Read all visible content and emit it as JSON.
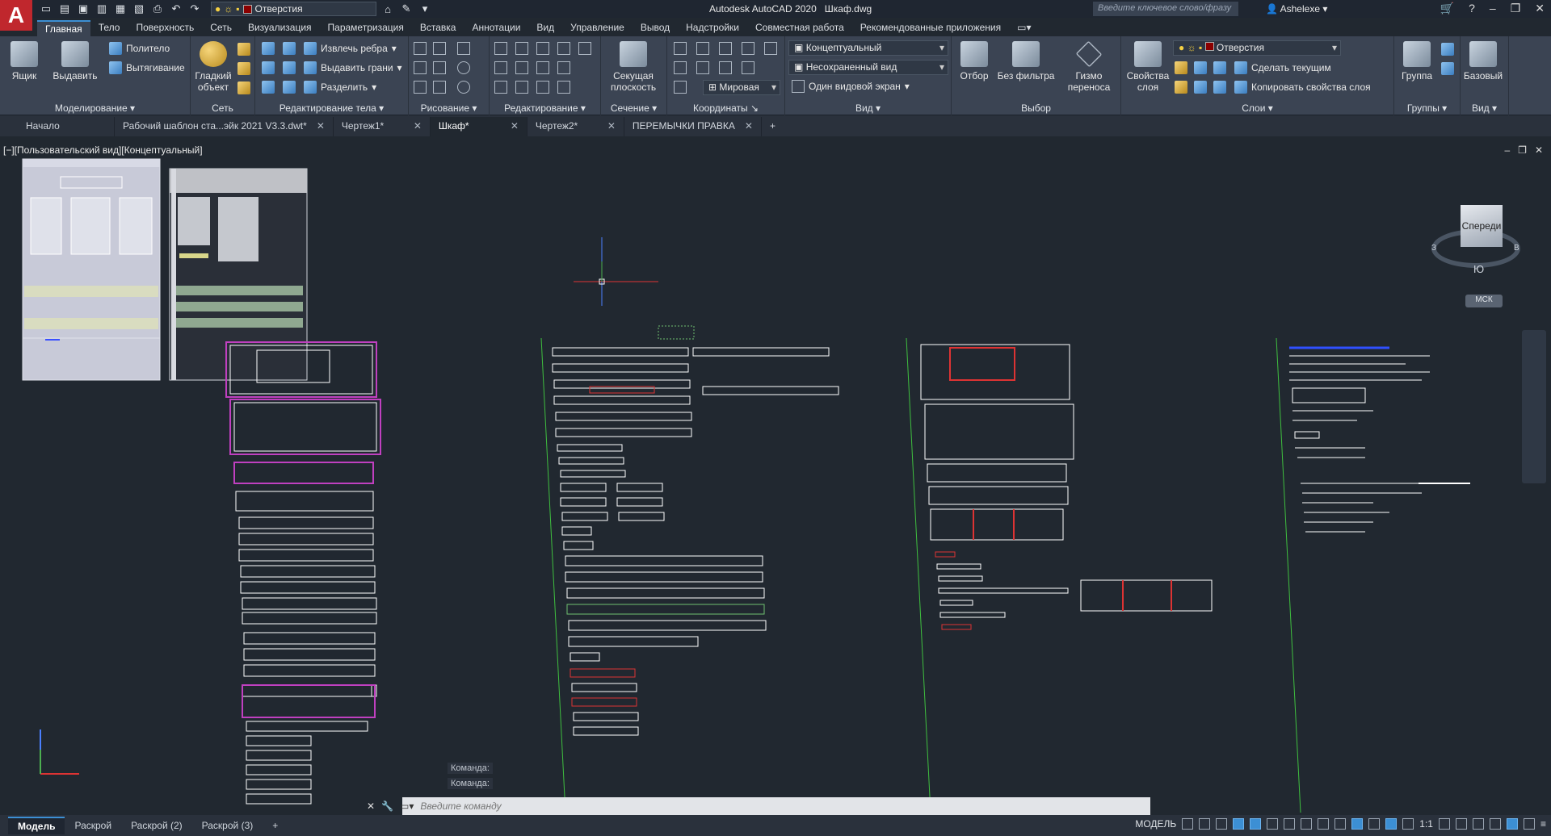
{
  "app": {
    "logo_letter": "A",
    "title": "Autodesk AutoCAD 2020",
    "file": "Шкаф.dwg",
    "search_placeholder": "Введите ключевое слово/фразу",
    "user": "Ashelexe"
  },
  "qat": {
    "current_layer": "Отверстия",
    "layer_color": "#8b0000"
  },
  "menu_tabs": [
    "Главная",
    "Тело",
    "Поверхность",
    "Сеть",
    "Визуализация",
    "Параметризация",
    "Вставка",
    "Аннотации",
    "Вид",
    "Управление",
    "Вывод",
    "Надстройки",
    "Совместная работа",
    "Рекомендованные приложения"
  ],
  "ribbon": {
    "modeling": {
      "title": "Моделирование",
      "box": "Ящик",
      "extrude": "Выдавить",
      "polysolid": "Политело",
      "presspull": "Вытягивание"
    },
    "mesh": {
      "title": "Сеть",
      "smooth_1": "Гладкий",
      "smooth_2": "объект"
    },
    "solid_edit": {
      "title": "Редактирование тела",
      "extract": "Извлечь ребра",
      "extrude_faces": "Выдавить грани",
      "separate": "Разделить"
    },
    "draw": {
      "title": "Рисование"
    },
    "modify": {
      "title": "Редактирование"
    },
    "section": {
      "title": "Сечение",
      "plane_1": "Секущая",
      "plane_2": "плоскость"
    },
    "coordinates": {
      "title": "Координаты",
      "world": "Мировая"
    },
    "view": {
      "title": "Вид",
      "visual_style": "Концептуальный",
      "named_view": "Несохраненный вид",
      "viewport": "Один видовой экран"
    },
    "selection": {
      "title": "Выбор",
      "culling": "Отбор",
      "no_filter": "Без фильтра",
      "gizmo_1": "Гизмо",
      "gizmo_2": "переноса"
    },
    "layers": {
      "title": "Слои",
      "props_1": "Свойства",
      "props_2": "слоя",
      "layer": "Отверстия",
      "make_current": "Сделать текущим",
      "match_layer": "Копировать свойства слоя"
    },
    "groups": {
      "title": "Группы",
      "group": "Группа"
    },
    "view2": {
      "title": "Вид",
      "base": "Базовый"
    }
  },
  "doc_tabs": [
    "Начало",
    "Рабочий шаблон ста...эйк 2021 V3.3.dwt*",
    "Чертеж1*",
    "Шкаф*",
    "Чертеж2*",
    "ПЕРЕМЫЧКИ ПРАВКА"
  ],
  "active_doc_index": 3,
  "viewport": {
    "label": "[−][Пользовательский вид][Концептуальный]",
    "viewcube_face": "Спереди",
    "viewcube_south": "Ю",
    "viewcube_west": "З",
    "viewcube_east": "В",
    "wcs": "МСК"
  },
  "command": {
    "history": [
      "Команда:",
      "Команда:"
    ],
    "placeholder": "Введите команду"
  },
  "layout_tabs": [
    "Модель",
    "Раскрой",
    "Раскрой (2)",
    "Раскрой (3)"
  ],
  "status": {
    "space": "МОДЕЛЬ",
    "scale": "1:1"
  }
}
